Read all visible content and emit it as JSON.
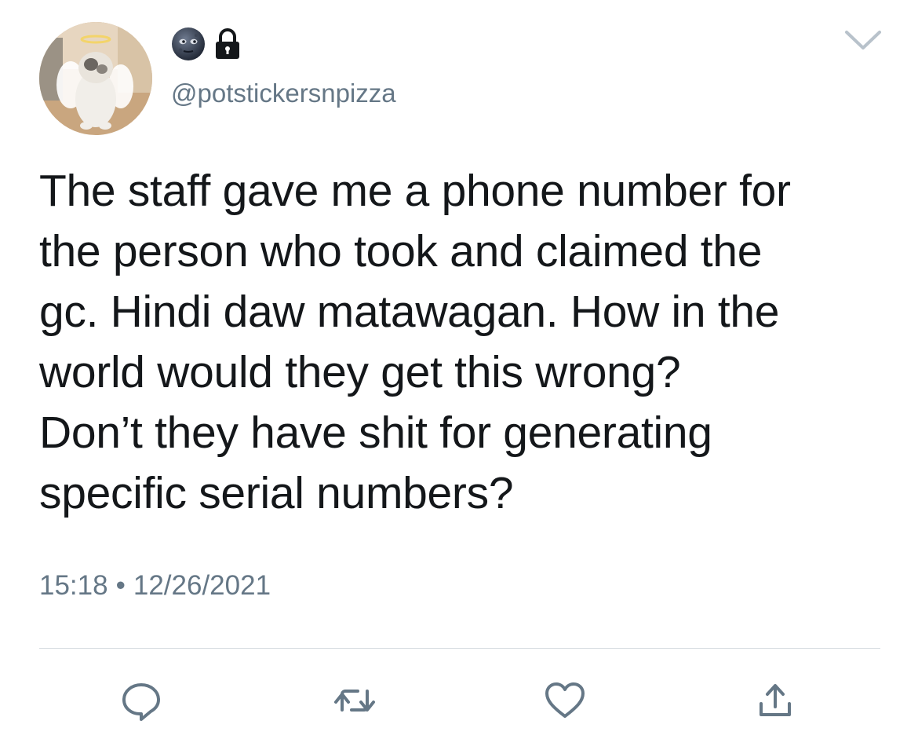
{
  "tweet": {
    "handle": "@potstickersnpizza",
    "text": "The staff gave me a phone number for\nthe person who took and claimed the\ngc. Hindi daw matawagan. How in the\nworld would they get this wrong?\nDon’t they have shit for generating\nspecific serial numbers?",
    "time": "15:18",
    "separator": "•",
    "date": "12/26/2021"
  },
  "icons": {
    "name_emoji_1": "new-moon-face-icon",
    "name_emoji_2": "lock-icon",
    "more": "chevron-down-icon",
    "actions": [
      "reply-icon",
      "retweet-icon",
      "like-icon",
      "share-icon"
    ]
  },
  "colors": {
    "text": "#14171a",
    "secondary": "#657786",
    "icon": "#657786",
    "divider": "#d5dbe0"
  }
}
